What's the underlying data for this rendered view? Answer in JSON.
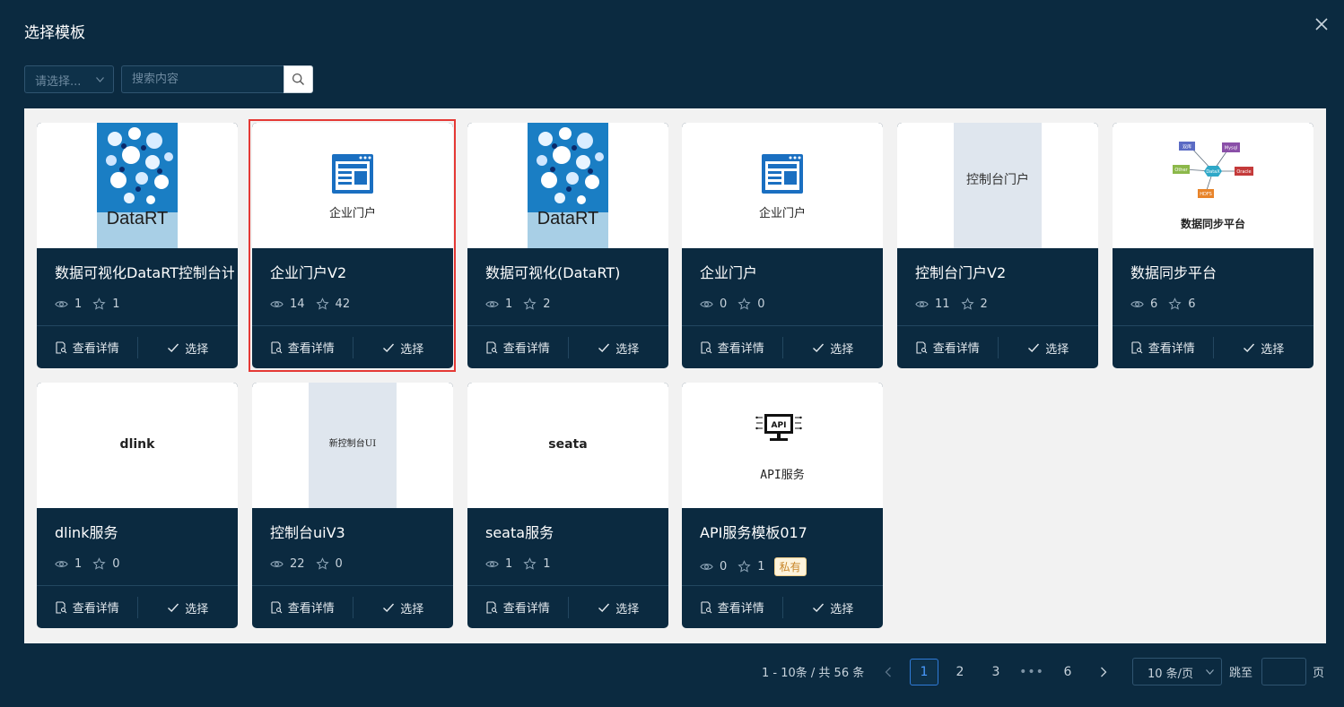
{
  "dialog": {
    "title": "选择模板"
  },
  "filter": {
    "placeholder": "请选择..."
  },
  "search": {
    "placeholder": "搜索内容"
  },
  "action_labels": {
    "detail": "查看详情",
    "select": "选择"
  },
  "cards": [
    {
      "name": "数据可视化DataRT控制台计",
      "views": "1",
      "stars": "1",
      "thumb_text": "DataRT"
    },
    {
      "name": "企业门户V2",
      "views": "14",
      "stars": "42",
      "thumb_text": "企业门户"
    },
    {
      "name": "数据可视化(DataRT)",
      "views": "1",
      "stars": "2",
      "thumb_text": "DataRT"
    },
    {
      "name": "企业门户",
      "views": "0",
      "stars": "0",
      "thumb_text": "企业门户"
    },
    {
      "name": "控制台门户V2",
      "views": "11",
      "stars": "2",
      "thumb_text": "控制台门户"
    },
    {
      "name": "数据同步平台",
      "views": "6",
      "stars": "6",
      "thumb_text": "数据同步平台",
      "diagram_labels": [
        "双库",
        "Mysql",
        "Other",
        "DataX",
        "Oracle",
        "HDFS"
      ]
    },
    {
      "name": "dlink服务",
      "views": "1",
      "stars": "0",
      "thumb_text": "dlink"
    },
    {
      "name": "控制台uiV3",
      "views": "22",
      "stars": "0",
      "thumb_text": "新控制台UI"
    },
    {
      "name": "seata服务",
      "views": "1",
      "stars": "1",
      "thumb_text": "seata"
    },
    {
      "name": "API服务模板017",
      "views": "0",
      "stars": "1",
      "thumb_text": "API服务",
      "badge": "私有",
      "icon_text": "API"
    }
  ],
  "pagination": {
    "summary": "1 - 10条 / 共 56 条",
    "pages": [
      "1",
      "2",
      "3",
      "•••",
      "6"
    ],
    "current": "1",
    "page_size": "10 条/页",
    "jump_label": "跳至",
    "page_suffix": "页"
  },
  "colors": {
    "accent": "#2f7bd8",
    "selected_border": "#e53935",
    "card_bg": "#0b2a40"
  }
}
